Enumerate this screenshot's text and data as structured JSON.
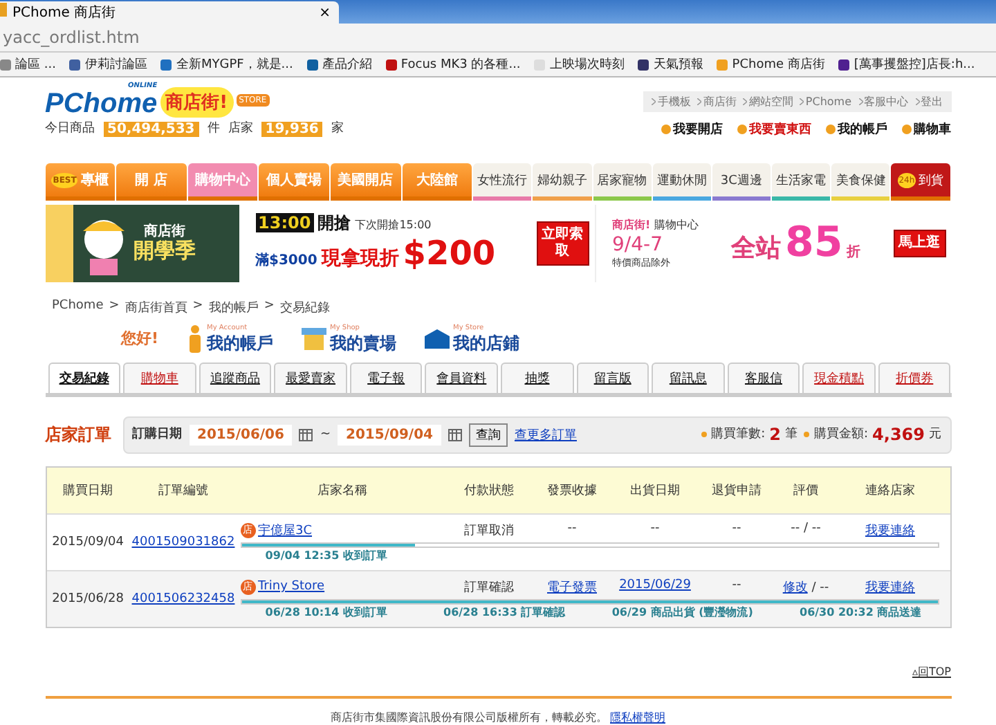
{
  "browser": {
    "tab_title": "PChome 商店街",
    "close": "×",
    "address": "yacc_ordlist.htm",
    "bookmarks": [
      {
        "label": "論區 ..."
      },
      {
        "label": "伊莉討論區"
      },
      {
        "label": "全新MYGPF，就是..."
      },
      {
        "label": "產品介紹"
      },
      {
        "label": "Focus MK3 的各種..."
      },
      {
        "label": "上映場次時刻"
      },
      {
        "label": "天氣預報"
      },
      {
        "label": "PChome 商店街"
      },
      {
        "label": "[萬事攫盤控]店長:h..."
      }
    ]
  },
  "header": {
    "logo": {
      "brand": "PChome",
      "online": "ONLINE",
      "store_name": "商店街!",
      "badge": "STORE"
    },
    "stats": [
      {
        "label": "今日商品",
        "value": "50,494,533",
        "unit": "件"
      },
      {
        "label": "店家",
        "value": "19,936",
        "unit": "家"
      }
    ],
    "top_links": [
      "手機板",
      "商店街",
      "網站空間",
      "PChome",
      "客服中心",
      "登出"
    ],
    "action_links": [
      {
        "label": "我要開店",
        "highlighted": false
      },
      {
        "label": "我要賣東西",
        "highlighted": true
      },
      {
        "label": "我的帳戶",
        "highlighted": false
      },
      {
        "label": "購物車",
        "highlighted": false
      }
    ]
  },
  "nav": [
    {
      "kind": "main",
      "label": "專櫃",
      "badge": "BEST",
      "selected": false
    },
    {
      "kind": "main",
      "label": "開 店",
      "selected": false
    },
    {
      "kind": "main",
      "label": "購物中心",
      "selected": true
    },
    {
      "kind": "main",
      "label": "個人賣場",
      "selected": false
    },
    {
      "kind": "main",
      "label": "美國開店",
      "selected": false
    },
    {
      "kind": "main",
      "label": "大陸館",
      "selected": false
    },
    {
      "kind": "category",
      "label": "女性流行",
      "color": "#e87aa8",
      "selected": false
    },
    {
      "kind": "category",
      "label": "婦幼親子",
      "color": "#f0a04a",
      "selected": false
    },
    {
      "kind": "category",
      "label": "居家寵物",
      "color": "#8cc84a",
      "selected": false
    },
    {
      "kind": "category",
      "label": "運動休閒",
      "color": "#4aa8e0",
      "selected": false
    },
    {
      "kind": "category",
      "label": "3C週邊",
      "color": "#8a7ad0",
      "selected": false
    },
    {
      "kind": "category",
      "label": "生活家電",
      "color": "#3ab8a8",
      "selected": false
    },
    {
      "kind": "category",
      "label": "美食保健",
      "color": "#e8d040",
      "selected": false
    },
    {
      "kind": "express",
      "label": "到貨",
      "badge": "24h",
      "selected": false
    }
  ],
  "banners": {
    "left": {
      "title": "商店街",
      "headline": "開學季"
    },
    "middle": {
      "time": "13:00",
      "action": "開搶",
      "next": "下次開搶15:00",
      "condition": "滿$3000",
      "offer": "現拿現折",
      "amount": "$200",
      "button": "立即索取"
    },
    "right": {
      "brand": "商店街!",
      "channel": "購物中心",
      "dates": "9/4-7",
      "note": "特價商品除外",
      "offer": "全站",
      "discount": "85",
      "unit": "折",
      "button": "馬上逛"
    }
  },
  "breadcrumb": [
    {
      "text": "PChome",
      "separator": ">"
    },
    {
      "text": "商店街首頁",
      "separator": ">"
    },
    {
      "text": "我的帳戶",
      "separator": ">"
    },
    {
      "text": "交易紀錄"
    }
  ],
  "account_menu": {
    "greeting": "您好!",
    "items": [
      {
        "sub": "My Account",
        "label": "我的帳戶",
        "kind": "person"
      },
      {
        "sub": "My Shop",
        "label": "我的賣場",
        "kind": "shop"
      },
      {
        "sub": "My Store",
        "label": "我的店鋪",
        "kind": "store"
      }
    ]
  },
  "tabs": [
    {
      "label": "交易紀錄",
      "selected": true,
      "highlighted": false
    },
    {
      "label": "購物車",
      "selected": false,
      "highlighted": true
    },
    {
      "label": "追蹤商品",
      "selected": false,
      "highlighted": false
    },
    {
      "label": "最愛賣家",
      "selected": false,
      "highlighted": false
    },
    {
      "label": "電子報",
      "selected": false,
      "highlighted": false
    },
    {
      "label": "會員資料",
      "selected": false,
      "highlighted": false
    },
    {
      "label": "抽獎",
      "selected": false,
      "highlighted": false
    },
    {
      "label": "留言版",
      "selected": false,
      "highlighted": false
    },
    {
      "label": "留訊息",
      "selected": false,
      "highlighted": false
    },
    {
      "label": "客服信",
      "selected": false,
      "highlighted": false
    },
    {
      "label": "現金積點",
      "selected": false,
      "highlighted": true
    },
    {
      "label": "折價券",
      "selected": false,
      "highlighted": true
    }
  ],
  "orders": {
    "title": "店家訂單",
    "date_label": "訂購日期",
    "date_from": "2015/06/06",
    "separator": "~",
    "date_to": "2015/09/04",
    "search_button": "查詢",
    "more_link": "查更多訂單",
    "summary": [
      {
        "label": "購買筆數:",
        "value": "2",
        "unit": "筆"
      },
      {
        "label": "購買金額:",
        "value": "4,369",
        "unit": "元"
      }
    ],
    "columns": [
      "購買日期",
      "訂單編號",
      "店家名稱",
      "付款狀態",
      "發票收據",
      "出貨日期",
      "退貨申請",
      "評價",
      "連絡店家"
    ],
    "rows": [
      {
        "date": "2015/09/04",
        "order_no": "4001509031862",
        "store_badge": "店",
        "store": "宇億屋3C",
        "payment": "訂單取消",
        "invoice": {
          "text": "--",
          "link": false
        },
        "ship_date": {
          "text": "--",
          "link": false
        },
        "return": "--",
        "rating_link": "",
        "rating_text": "-- / --",
        "contact": "我要連絡",
        "level": 0.25,
        "steps": [
          "09/04 12:35 收到訂單"
        ]
      },
      {
        "date": "2015/06/28",
        "order_no": "4001506232458",
        "store_badge": "店",
        "store": "Triny Store",
        "payment": "訂單確認",
        "invoice": {
          "text": "電子發票",
          "link": true
        },
        "ship_date": {
          "text": "2015/06/29",
          "link": true
        },
        "return": "--",
        "rating_link": "修改",
        "rating_text": "/ --",
        "contact": "我要連絡",
        "level": 1,
        "steps": [
          "06/28 10:14 收到訂單",
          "06/28 16:33 訂單確認",
          "06/29 商品出貨 (豐瀅物流)",
          "06/30 20:32 商品送達"
        ]
      }
    ]
  },
  "back_to_top": "▵回TOP",
  "footer": {
    "text": "商店街市集國際資訊股份有限公司版權所有，轉載必究。",
    "link": "隱私權聲明"
  }
}
